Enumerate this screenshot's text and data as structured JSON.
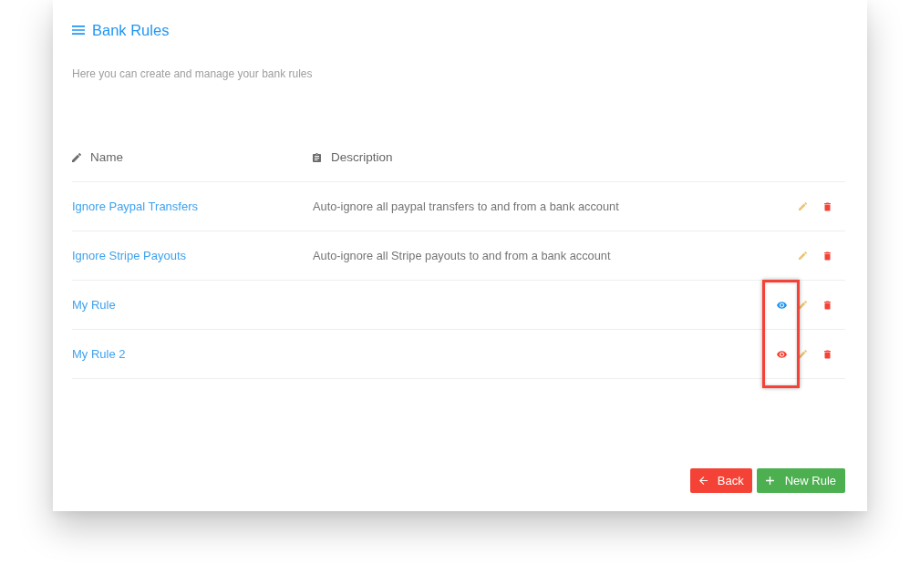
{
  "page": {
    "title": "Bank Rules",
    "subtitle": "Here you can create and manage your bank rules"
  },
  "table": {
    "columns": [
      {
        "label": "Name",
        "kind": "name"
      },
      {
        "label": "Description",
        "kind": "description"
      }
    ],
    "rows": [
      {
        "name": "Ignore Paypal Transfers",
        "description": "Auto-ignore all paypal transfers to and from a bank account",
        "highlighted": false
      },
      {
        "name": "Ignore Stripe Payouts",
        "description": "Auto-ignore all Stripe payouts to and from a bank account",
        "highlighted": false
      },
      {
        "name": "My Rule",
        "eye": {
          "color": "#2196f3"
        },
        "highlighted": true
      },
      {
        "name": "My Rule 2",
        "eye": {
          "color": "#f44336"
        },
        "highlighted": true
      }
    ]
  },
  "buttons": [
    {
      "label": "Back",
      "kind": "back"
    },
    {
      "label": "New Rule",
      "kind": "add"
    }
  ]
}
